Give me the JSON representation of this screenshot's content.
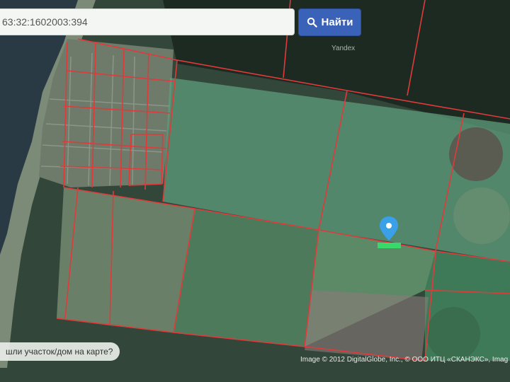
{
  "search": {
    "value": "63:32:1602003:394",
    "button_label": "Найти"
  },
  "map": {
    "provider": "Yandex",
    "hint": "шли участок/дом на карте?",
    "copyright": "Image © 2012 DigitalGlobe, Inc., © ООО ИТЦ «СКАНЭКС», Imag",
    "boundary_color": "#e03a3a",
    "marker_color": "#3aa0e8"
  }
}
